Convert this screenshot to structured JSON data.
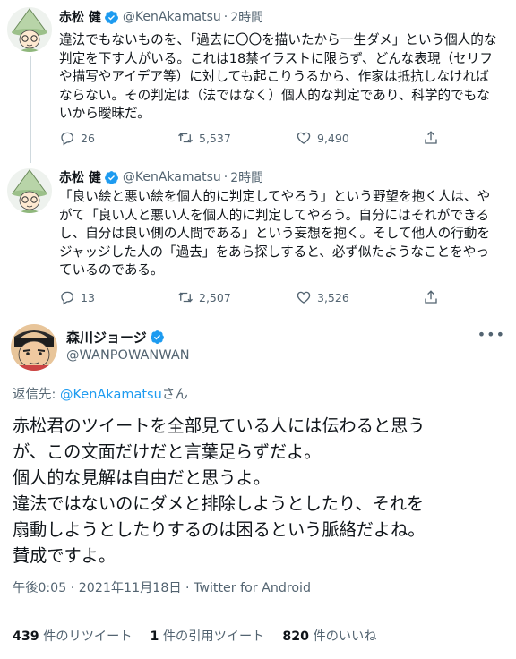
{
  "tweets": [
    {
      "name": "赤松 健",
      "handle": "@KenAkamatsu",
      "time": "2時間",
      "lines": [
        "違法でもないものを、「過去に〇〇を描いたから一生ダメ」という個人的な",
        "判定を下す人がいる。これは18禁イラストに限らず、どんな表現（セリフ",
        "や描写やアイデア等）に対しても起こりうるから、作家は抵抗しなければ",
        "ならない。その判定は（法ではなく）個人的な判定であり、科学的でもな",
        "いから曖昧だ。"
      ],
      "replies": "26",
      "retweets": "5,537",
      "likes": "9,490"
    },
    {
      "name": "赤松 健",
      "handle": "@KenAkamatsu",
      "time": "2時間",
      "lines": [
        "「良い絵と悪い絵を個人的に判定してやろう」という野望を抱く人は、や",
        "がて「良い人と悪い人を個人的に判定してやろう。自分にはそれができる",
        "し、自分は良い側の人間である」という妄想を抱く。そして他人の行動を",
        "ジャッジした人の「過去」をあら探しすると、必ず似たようなことをやっ",
        "ているのである。"
      ],
      "replies": "13",
      "retweets": "2,507",
      "likes": "3,526"
    }
  ],
  "main": {
    "name": "森川ジョージ",
    "handle": "@WANPOWANWAN",
    "reply_prefix": "返信先: ",
    "reply_link": "@KenAkamatsu",
    "reply_suffix": "さん",
    "lines": [
      "赤松君のツイートを全部見ている人には伝わると思う",
      "が、この文面だけだと言葉足らずだよ。",
      "個人的な見解は自由だと思うよ。",
      "違法ではないのにダメと排除しようとしたり、それを",
      "扇動しようとしたりするのは困るという脈絡だよね。",
      "賛成ですよ。"
    ],
    "timestamp": "午後0:05 · 2021年11月18日 · Twitter for Android",
    "stats": [
      {
        "count": "439",
        "label": "件のリツイート"
      },
      {
        "count": "1",
        "label": "件の引用ツイート"
      },
      {
        "count": "820",
        "label": "件のいいね"
      }
    ]
  },
  "colors": {
    "accent": "#1d9bf0",
    "secondary_text": "#536471",
    "line": "#cfd9de"
  },
  "icons": [
    "verified-badge-icon",
    "reply-icon",
    "retweet-icon",
    "like-icon",
    "share-icon",
    "more-icon"
  ]
}
